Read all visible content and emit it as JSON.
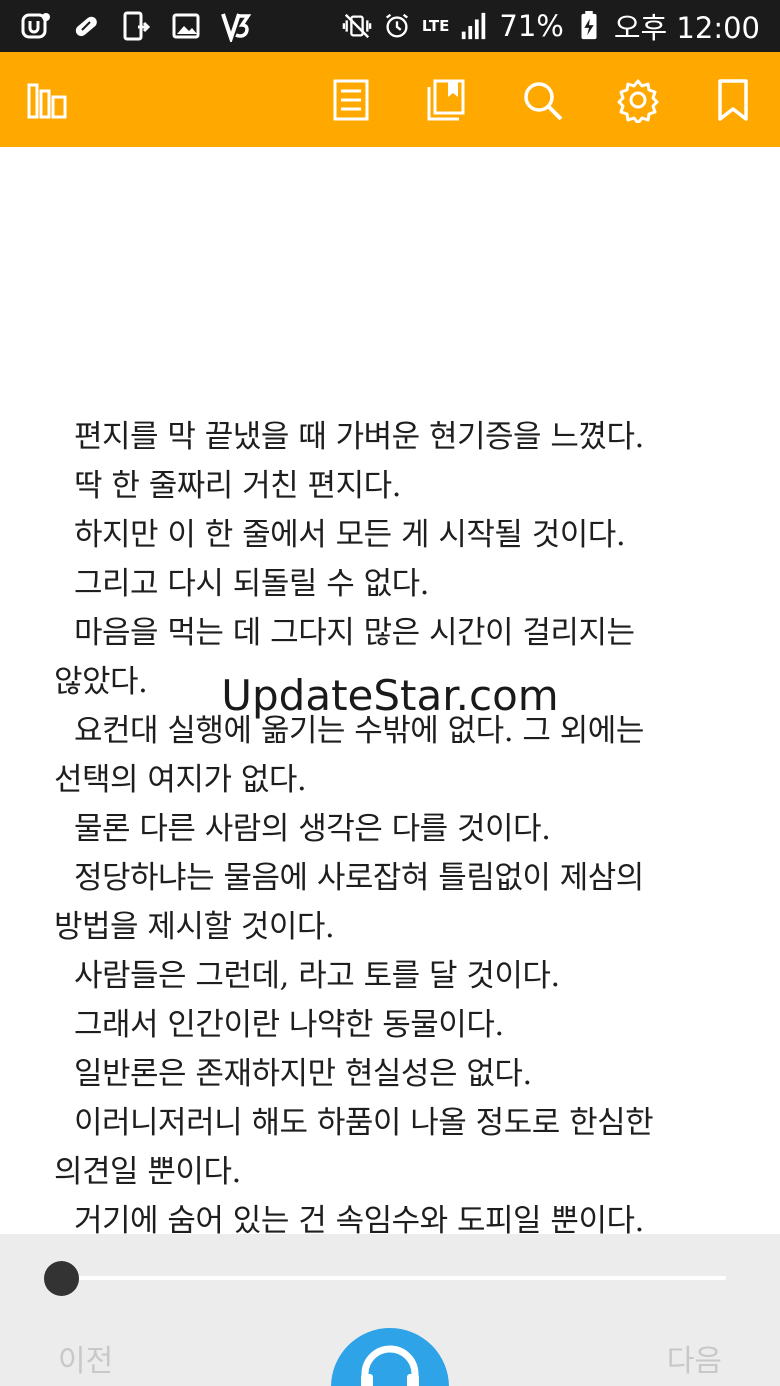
{
  "status_bar": {
    "battery": "71%",
    "network": "LTE",
    "time": "오후 12:00"
  },
  "toolbar": {
    "left_icon": "library-icon",
    "right_icons": [
      "toc-icon",
      "bookmarks-list-icon",
      "search-icon",
      "settings-icon",
      "bookmark-icon"
    ]
  },
  "reader": {
    "paragraphs": [
      "편지를 막 끝냈을 때 가벼운 현기증을 느꼈다.",
      "딱 한 줄짜리 거친 편지다.",
      "하지만 이 한 줄에서 모든 게 시작될 것이다.",
      "그리고 다시 되돌릴 수 없다.",
      "마음을 먹는 데 그다지 많은 시간이 걸리지는 않았다.",
      "요컨대 실행에 옮기는 수밖에 없다. 그 외에는 선택의 여지가 없다.",
      "물론 다른 사람의 생각은 다를 것이다.",
      "정당하냐는 물음에 사로잡혀 틀림없이 제삼의 방법을 제시할 것이다.",
      "사람들은 그런데, 라고 토를 달 것이다.",
      "그래서 인간이란 나약한 동물이다.",
      "일반론은 존재하지만 현실성은 없다.",
      "이러니저러니 해도 하품이 나올 정도로 한심한 의견일 뿐이다.",
      "거기에 숨어 있는 건 속임수와 도피일 뿐이다."
    ],
    "watermark": "UpdateStar.com"
  },
  "bottom_bar": {
    "prev_label": "이전",
    "next_label": "다음",
    "progress": 0
  },
  "colors": {
    "toolbar": "#ffa800",
    "status_bar": "#1b1b1b",
    "audio_button": "#2ea3e8"
  }
}
